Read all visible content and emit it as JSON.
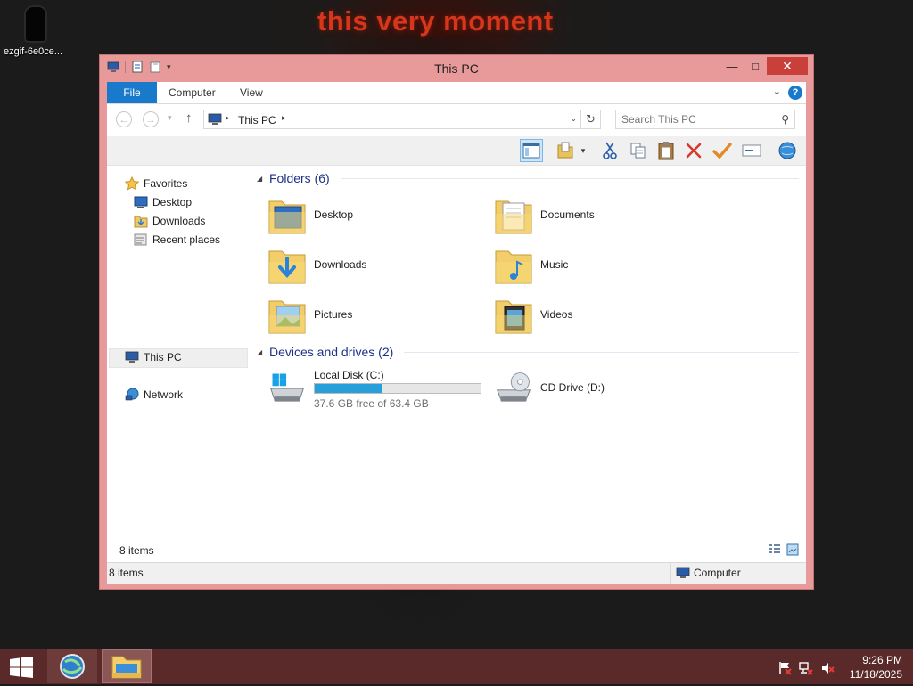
{
  "desktop": {
    "wallpaper_text": "this very moment",
    "icon_label": "ezgif-6e0ce..."
  },
  "window": {
    "title": "This PC",
    "title_color": "#e89a9a"
  },
  "ribbon": {
    "tabs": [
      "File",
      "Computer",
      "View"
    ]
  },
  "address": {
    "path": "This PC",
    "search_placeholder": "Search This PC"
  },
  "navigation": {
    "favorites": "Favorites",
    "desktop": "Desktop",
    "downloads": "Downloads",
    "recent": "Recent places",
    "this_pc": "This PC",
    "network": "Network"
  },
  "folders": {
    "header": "Folders (6)",
    "items": [
      "Desktop",
      "Documents",
      "Downloads",
      "Music",
      "Pictures",
      "Videos"
    ]
  },
  "drives": {
    "header": "Devices and drives (2)",
    "local": {
      "name": "Local Disk (C:)",
      "free": "37.6 GB free of 63.4 GB",
      "used_fraction": 0.407
    },
    "cd": {
      "name": "CD Drive (D:)"
    }
  },
  "status": {
    "items_inner": "8 items",
    "items_bar": "8 items",
    "location": "Computer"
  },
  "taskbar": {
    "time": "9:26 PM",
    "date": "11/18/2025"
  },
  "colors": {
    "accent": "#1979ca",
    "drive_bar": "#26a0da",
    "taskbar": "#5a2a2a"
  }
}
